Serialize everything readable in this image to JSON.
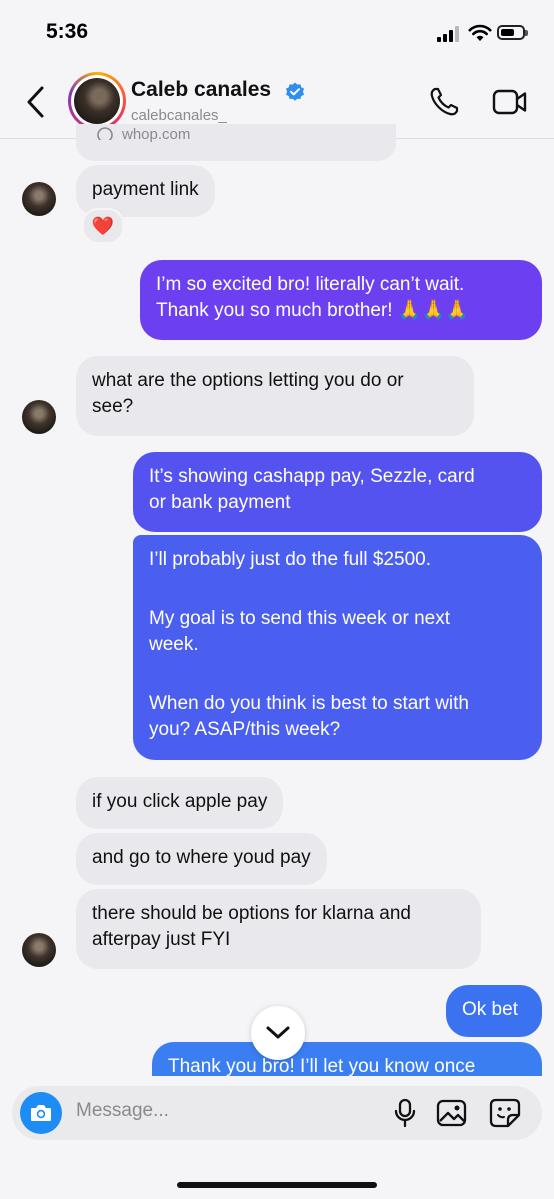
{
  "status_bar": {
    "time": "5:36"
  },
  "header": {
    "name": "Caleb canales",
    "handle": "calebcanales_"
  },
  "link_preview_text": "whop.com",
  "messages": [
    {
      "from": "them",
      "text": "payment link",
      "reaction": "❤️"
    },
    {
      "from": "me",
      "lines": [
        "I’m so excited bro! literally can’t wait.",
        "Thank you so much brother! 🙏🙏🙏"
      ]
    },
    {
      "from": "them",
      "lines": [
        "what are the options letting you do or",
        "see?"
      ]
    },
    {
      "from": "me",
      "lines": [
        "It’s showing cashapp pay, Sezzle, card",
        "or bank payment"
      ]
    },
    {
      "from": "me",
      "paragraphs": [
        "I’ll probably just do the full $2500.",
        "My goal is to send this week or next",
        "week.",
        "When do you think is best to start with",
        "you? ASAP/this week?"
      ]
    },
    {
      "from": "them",
      "text": "if you click apple pay"
    },
    {
      "from": "them",
      "text": "and go to where youd pay"
    },
    {
      "from": "them",
      "lines": [
        "there should be options for klarna and",
        "afterpay just FYI"
      ]
    },
    {
      "from": "me",
      "text": "Ok bet"
    },
    {
      "from": "me",
      "text": "Thank you bro! I’ll let you know once"
    }
  ],
  "composer": {
    "placeholder": "Message..."
  },
  "colors": {
    "accent": "#1d8cf5",
    "bubble_purple": "#6a3df0",
    "bubble_blue": "#3b64f0",
    "bubble_incoming": "#e9e9ed"
  }
}
